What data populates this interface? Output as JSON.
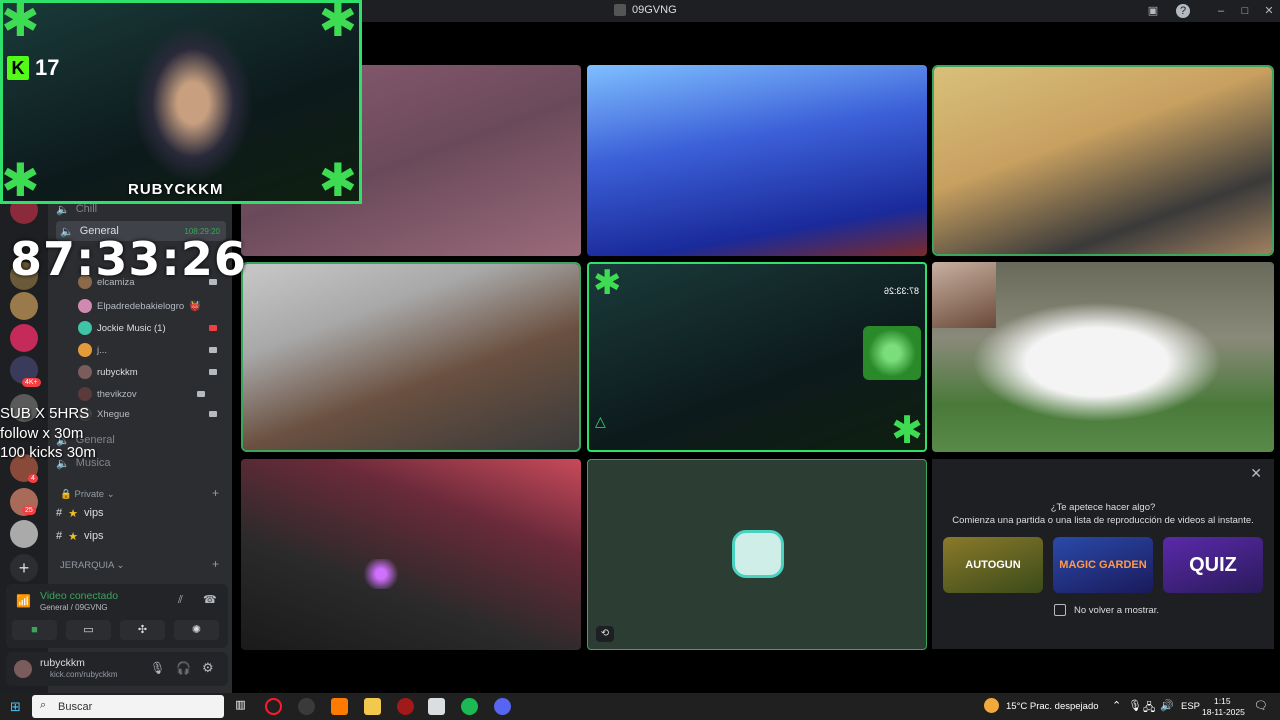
{
  "titlebar": {
    "title": "09GVNG"
  },
  "overlay": {
    "kick_followers": "17",
    "streamer_name": "RUBYCKKM",
    "timer": "87:33:26",
    "sub_lines": [
      "SUB X 5HRS",
      "follow x 30m",
      "100 kicks 30m"
    ]
  },
  "sidebar": {
    "channels": [
      {
        "label": "Chill"
      },
      {
        "label": "General",
        "time": "108:29:20"
      }
    ],
    "users": [
      {
        "name": "elcamiza",
        "color": "#8a6a4a"
      },
      {
        "name": "Elpadredebakielogro",
        "color": "#d08ab0",
        "emoji": "👹"
      },
      {
        "name": "Jockie Music (1)",
        "color": "#3fc4a6"
      },
      {
        "name": "j...",
        "color": "#e39a3b"
      },
      {
        "name": "rubyckkm",
        "color": "#7a5c5c"
      },
      {
        "name": "thevikzov",
        "color": "#5a3a3a"
      },
      {
        "name": "Xhegue",
        "color": "#444"
      }
    ],
    "more_channels": [
      {
        "label": "General"
      },
      {
        "label": "Musica"
      }
    ],
    "categories": {
      "private": "Private",
      "jerarquia": "JERARQUIA"
    },
    "private_channels": [
      {
        "label": "vips"
      },
      {
        "label": "vips"
      }
    ],
    "rail_badges": [
      "4K+",
      "4",
      "25"
    ]
  },
  "voice": {
    "status": "Video conectado",
    "location": "General / 09GVNG"
  },
  "user": {
    "name": "rubyckkm",
    "subtitle": "kick.com/rubyckkm"
  },
  "grid": {
    "tiles": [
      {
        "id": "t1",
        "label": "room-cam-1"
      },
      {
        "id": "t2",
        "label": "blue-bedroom-cam"
      },
      {
        "id": "t3",
        "label": "headset-user-cam"
      },
      {
        "id": "t4",
        "label": "grey-beanie-user-cam"
      },
      {
        "id": "t5",
        "label": "stream-overlay-cam"
      },
      {
        "id": "t6",
        "label": "goat-video"
      },
      {
        "id": "t7",
        "label": "rgb-headset-cam"
      },
      {
        "id": "t8",
        "label": "empty-activity-tile"
      }
    ],
    "stream_timer_mirror": "87:33:26"
  },
  "activity": {
    "prompt": "¿Te apetece hacer algo?",
    "subtitle": "Comienza una partida o una lista de reproducción de videos al instante.",
    "games": [
      {
        "title": "AUTOGUN",
        "color": "#6a5a1a"
      },
      {
        "title": "MAGIC GARDEN",
        "color": "#1f3a7a"
      },
      {
        "title": "QUIZ",
        "color": "#3a1f6a"
      }
    ],
    "dont_show": "No volver a mostrar."
  },
  "taskbar": {
    "search_placeholder": "Buscar",
    "weather": "15°C  Prac. despejado",
    "lang": "ESP",
    "time": "1:15",
    "date": "18-11-2025"
  }
}
